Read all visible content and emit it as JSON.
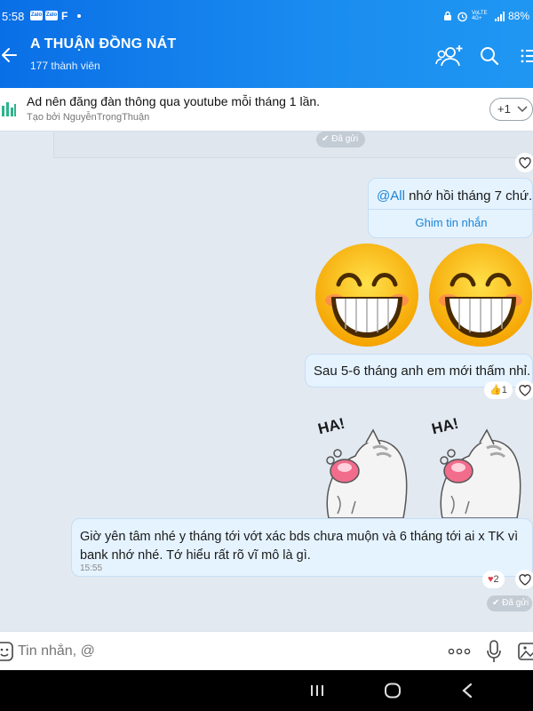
{
  "status": {
    "time": "5:58",
    "mini1": "Zalo",
    "mini2": "Zalo",
    "f_icon": "F",
    "network": "VoLTE 4G+",
    "battery": "88%"
  },
  "header": {
    "title": "A THUẬN ĐỒNG NÁT",
    "members": "177 thành viên",
    "icons": [
      "back-arrow-icon",
      "add-member-icon",
      "search-icon",
      "menu-list-icon"
    ]
  },
  "pinned": {
    "text": "Ad nên đăng đàn thông qua youtube mỗi tháng 1 lần.",
    "by": "Tạo bởi NguyễnTrọngThuận",
    "more": "+1"
  },
  "messages": [
    {
      "type": "status",
      "text": "Đã gửi"
    },
    {
      "type": "text",
      "mention": "@All",
      "text": " nhớ hồi tháng 7 chứ.",
      "action": "Ghim tin nhắn"
    },
    {
      "type": "emoji",
      "count": 2,
      "icon": "grinning-face-emoji"
    },
    {
      "type": "text",
      "text": "Sau 5-6 tháng anh em mới thấm nhỉ.",
      "reaction": "1",
      "reaction_icon": "thumbs-up-icon"
    },
    {
      "type": "sticker",
      "count": 2,
      "label": "HA!",
      "icon": "laughing-cat-sticker"
    },
    {
      "type": "text",
      "text_line1": "Giờ yên tâm nhé y tháng tới vớt xác bds chưa muộn và 6 tháng tới ai x TK vì",
      "text_line2": "bank nhớ nhé. Tớ hiểu rất rõ vĩ mô là gì.",
      "time": "15:55",
      "reaction": "2",
      "reaction_icon": "heart-icon"
    },
    {
      "type": "status",
      "text": "Đã gửi"
    }
  ],
  "input": {
    "placeholder": "Tin nhắn, @"
  },
  "colors": {
    "header": "#0a6fe6",
    "bubble": "#e5f3ff",
    "bubble_border": "#c6def5",
    "link": "#1a84d6",
    "bg": "#e2e9f1"
  }
}
